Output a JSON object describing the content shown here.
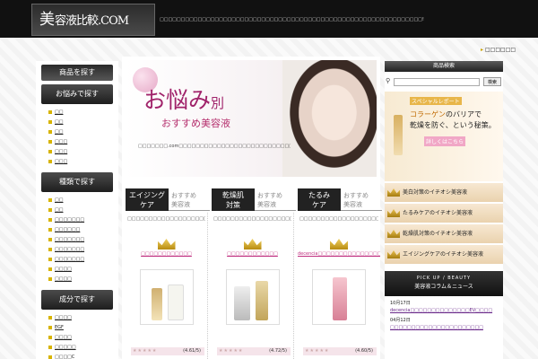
{
  "header": {
    "logo_big": "美",
    "logo_mid": "容液",
    "logo_rest": "比較.COM",
    "tagline": "□□□□□□□□□□□□□□□□□□□□□□□□□□□□□□□□□□□□□□□□□□□□□□□□□□□□□□□□□□□□□□!"
  },
  "sitemap": "□□□□□□",
  "sidebar": {
    "title": "商品を探す",
    "sec1": "お悩みで探す",
    "list1": [
      "□□",
      "□□",
      "□□",
      "□□□",
      "□□□",
      "□□□"
    ],
    "sec2": "種類で探す",
    "list2": [
      "□□",
      "□□",
      "□□□□□□□",
      "□□□□□□",
      "□□□□□□□",
      "□□□□□□□",
      "□□□□□□□",
      "□□□□",
      "□□□□"
    ],
    "sec3": "成分で探す",
    "list3": [
      "□□□□",
      "EGF",
      "□□□□",
      "□□□□□",
      "□□□□C",
      "□□□□"
    ]
  },
  "hero": {
    "title_main": "お悩み",
    "title_sub": "別",
    "subtitle": "おすすめ美容液",
    "text": "□□□□□□□.com□□□□□□□□□□□□□□□□□□□□□□□□□□□□□□□□□□□□□□□□□□□□□□□□□□□□□□□□□□□□□□□□□□□□□□□□□□□□□□□□□□□□□□□□□□□□□□□□□□□□□□□□□□□□□□□□"
  },
  "categories": [
    {
      "label_1": "エイジング",
      "label_2": "ケア",
      "sub_1": "おすすめ",
      "sub_2": "美容液",
      "desc": "□□□□□□□□□□□□□□□□□□□□□□□□□□□□□□□□□□□□□□",
      "link": "□□□□□□□□□□□□",
      "score": "(4.61/5)"
    },
    {
      "label_1": "乾燥肌",
      "label_2": "対策",
      "sub_1": "おすすめ",
      "sub_2": "美容液",
      "desc": "□□□□□□□□□□□□□□□□□□□□□□□□□□□□□□□□□□□□□□",
      "link": "□□□□□□□□□□□□",
      "score": "(4.72/5)"
    },
    {
      "label_1": "たるみ",
      "label_2": "ケア",
      "sub_1": "おすすめ",
      "sub_2": "美容液",
      "desc": "□□□□□□□□□□□□□□□□□□□□□□□□□□□□□□□□□□□□□□",
      "link": "decencia□□□□□□□□□□□□□□□EV□□□□□",
      "score": "(4.60/5)"
    }
  ],
  "right": {
    "search_title": "商品検索",
    "search_placeholder": "",
    "search_button": "検索",
    "special_tag": "スペシャルレポート",
    "special_l1a": "コラーゲン",
    "special_l1b": "のバリアで",
    "special_l2": "乾燥を防ぐ、という秘策。",
    "special_btn": "詳しくはこちら",
    "links": [
      "美白対策のイチオシ美容液",
      "たるみケアのイチオシ美容液",
      "乾燥肌対策のイチオシ美容液",
      "エイジングケアのイチオシ美容液"
    ],
    "column_top": "PICK UP / BEAUTY",
    "column_bottom": "美容液コラム＆ニュース",
    "news": [
      {
        "date": "10月17日",
        "link": "decencia□□□□□□□□□□□□□□EV□□□□"
      },
      {
        "date": "04月12日",
        "link": "□□□□□□□□□□□□□□□□□□□□□□"
      }
    ]
  },
  "colors": {
    "accent": "#d7b400",
    "pink": "#c03080",
    "dark": "#111111"
  }
}
